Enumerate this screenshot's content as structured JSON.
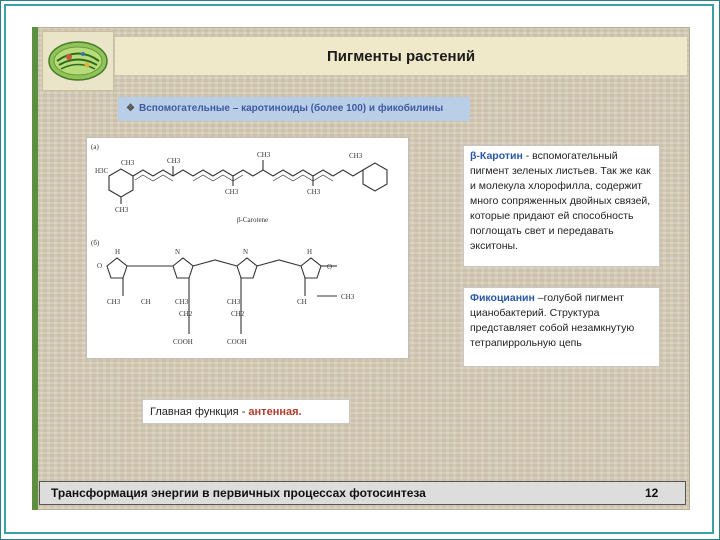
{
  "slide": {
    "title": "Пигменты растений",
    "subheading_prefix": "Вспомогательные – ",
    "subheading_rest": "каротиноиды (более 100) и фикобилины",
    "footer": "Трансформация энергии в первичных процессах фотосинтеза",
    "page_number": "12"
  },
  "diagram": {
    "panel_a_label": "(а)",
    "panel_b_label": "(б)",
    "caption_a": "β-Carotene",
    "atoms": [
      "H3C",
      "CH3",
      "CH3",
      "CH3",
      "CH3",
      "CH3",
      "CH3",
      "CH3",
      "O",
      "N",
      "H",
      "CH3",
      "CH",
      "CH2",
      "COOH"
    ]
  },
  "cards": {
    "carotene_title": "β-Каротин",
    "carotene_body": " - вспомогательный пигмент зеленых листьев. Так же как и молекула хлорофилла, содержит много сопряженных двойных связей, которые придают ей способность поглощать свет и передавать экситоны.",
    "phyco_title": "Фикоцианин",
    "phyco_body": " –голубой пигмент цианобактерий. Структура представляет собой незамкнутую тетрапиррольную цепь",
    "function_label": "Главная функция - ",
    "function_value": "антенная."
  },
  "colors": {
    "accent_blue": "#2a58a6",
    "accent_red": "#b23a2a",
    "subhead_bg": "#b9cfe8",
    "frame": "#3aa0a8"
  }
}
